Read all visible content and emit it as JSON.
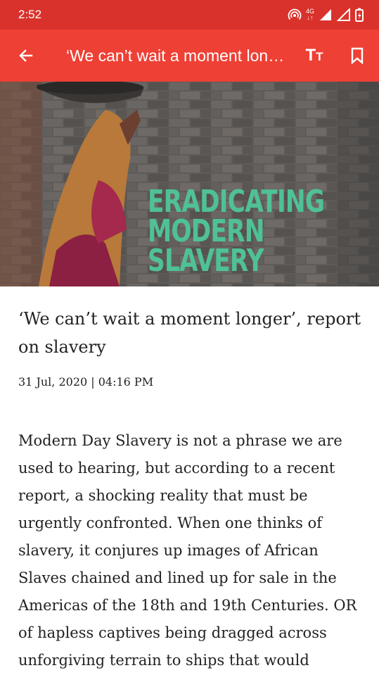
{
  "status_bar": {
    "time": "2:52",
    "network": "4G",
    "icons": [
      "hotspot-icon",
      "network-4g-icon",
      "signal-icon",
      "signal-empty-icon",
      "battery-icon"
    ]
  },
  "app_bar": {
    "title": "‘We can’t wait a moment longer’, report on slavery",
    "text_size_label": "TT",
    "icons": [
      "back-arrow-icon",
      "text-size-icon",
      "bookmark-icon"
    ]
  },
  "hero": {
    "lines": [
      "ERADICATING",
      "MODERN",
      "SLAVERY"
    ],
    "text_color": "#4fc197"
  },
  "article": {
    "headline": "‘We can’t wait a moment longer’, report on slavery",
    "dateline": "31 Jul, 2020 | 04:16 PM",
    "body": "Modern Day Slavery is not a phrase we are used to hearing, but according to a recent report, a shocking reality that must be urgently confronted. When one thinks of slavery, it conjures up images of African Slaves chained and lined up for sale in the Americas of the 18th and 19th Centuries. OR of hapless captives being dragged across unforgiving terrain to ships that would"
  },
  "colors": {
    "status_bar": "#d9322c",
    "app_bar": "#ee4035",
    "text": "#222222"
  }
}
